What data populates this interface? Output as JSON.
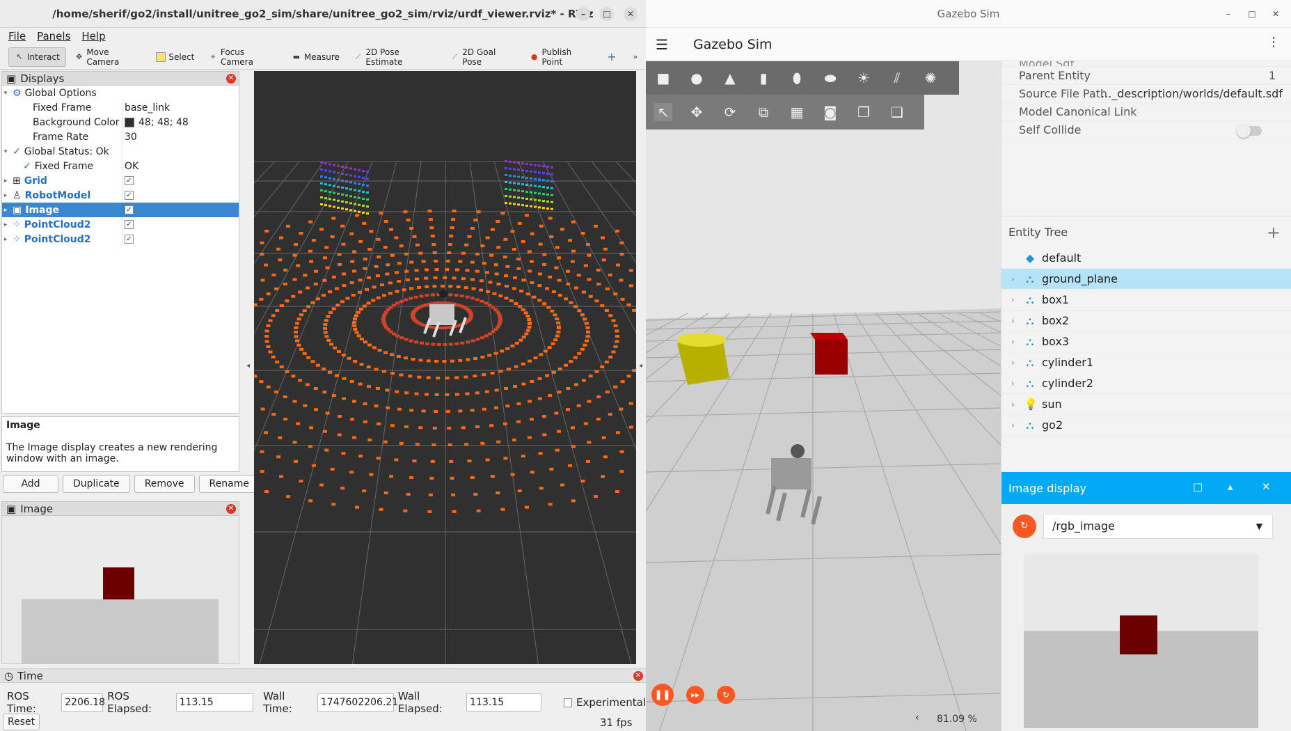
{
  "rviz": {
    "title": "/home/sherif/go2/install/unitree_go2_sim/share/unitree_go2_sim/rviz/urdf_viewer.rviz* - RViz",
    "menu": [
      "File",
      "Panels",
      "Help"
    ],
    "tools": [
      "Interact",
      "Move Camera",
      "Select",
      "Focus Camera",
      "Measure",
      "2D Pose Estimate",
      "2D Goal Pose",
      "Publish Point"
    ],
    "displays_title": "Displays",
    "tree": {
      "global_options": "Global Options",
      "fixed_frame_label": "Fixed Frame",
      "fixed_frame_value": "base_link",
      "bg_color_label": "Background Color",
      "bg_color_value": "48; 48; 48",
      "frame_rate_label": "Frame Rate",
      "frame_rate_value": "30",
      "global_status": "Global Status: Ok",
      "status_fixed_frame": "Fixed Frame",
      "status_fixed_frame_value": "OK",
      "grid": "Grid",
      "robot_model": "RobotModel",
      "image": "Image",
      "pc1": "PointCloud2",
      "pc2": "PointCloud2"
    },
    "desc_title": "Image",
    "desc_text": "The Image display creates a new rendering window with an image.",
    "buttons": {
      "add": "Add",
      "duplicate": "Duplicate",
      "remove": "Remove",
      "rename": "Rename"
    },
    "image_panel_title": "Image",
    "time": {
      "title": "Time",
      "ros_time_label": "ROS Time:",
      "ros_time": "2206.18",
      "ros_elapsed_label": "ROS Elapsed:",
      "ros_elapsed": "113.15",
      "wall_time_label": "Wall Time:",
      "wall_time": "1747602206.21",
      "wall_elapsed_label": "Wall Elapsed:",
      "wall_elapsed": "113.15",
      "experimental": "Experimental",
      "reset": "Reset",
      "fps": "31 fps"
    }
  },
  "gazebo": {
    "window_title": "Gazebo Sim",
    "app_title": "Gazebo Sim",
    "zoom": "81.09 %",
    "props": {
      "partial": "Model Sdf",
      "parent_entity_label": "Parent Entity",
      "parent_entity_value": "1",
      "source_label": "Source File Path",
      "source_value": "..._description/worlds/default.sdf",
      "canonical_label": "Model Canonical Link",
      "self_collide_label": "Self Collide"
    },
    "entity_tree_title": "Entity Tree",
    "entities": [
      "default",
      "ground_plane",
      "box1",
      "box2",
      "box3",
      "cylinder1",
      "cylinder2",
      "sun",
      "go2"
    ],
    "image_display": {
      "title": "Image display",
      "topic": "/rgb_image"
    }
  },
  "colors": {
    "accent_blue": "#03a9f4",
    "orange": "#ff5722",
    "rviz_bg": "#303030",
    "cube": "#6b0000"
  }
}
